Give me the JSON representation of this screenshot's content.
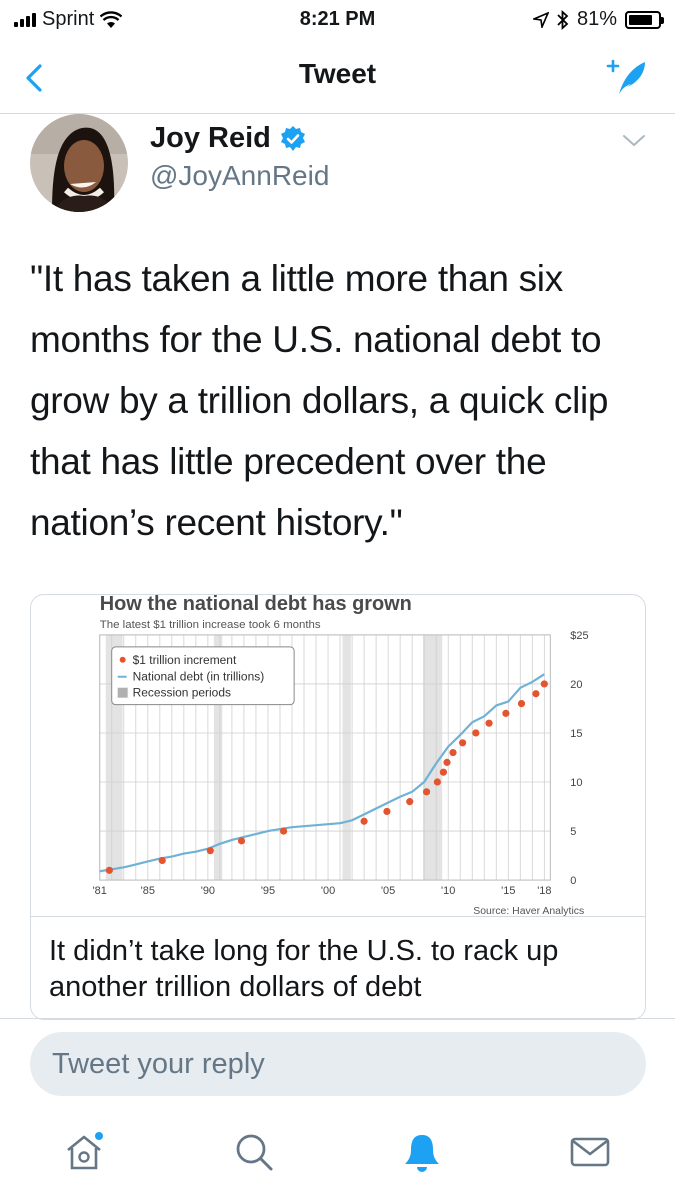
{
  "status_bar": {
    "carrier": "Sprint",
    "time": "8:21 PM",
    "battery": "81%",
    "battery_level": 0.81
  },
  "nav": {
    "title": "Tweet"
  },
  "tweet": {
    "author_name": "Joy Reid",
    "author_handle": "@JoyAnnReid",
    "text": "\"It has taken a little more than six months for the U.S. national debt to grow by a trillion dollars, a quick clip that has little precedent over the nation’s recent history.\""
  },
  "card": {
    "headline": "It didn’t take long for the U.S. to rack up another trillion dollars of debt"
  },
  "chart_data": {
    "type": "line",
    "title": "How the national debt has grown",
    "subtitle": "The latest $1 trillion increase took 6 months",
    "source": "Source: Haver Analytics",
    "legend": [
      "$1 trillion increment",
      "National debt (in trillions)",
      "Recession periods"
    ],
    "legend_placement": "top-left",
    "x_ticks": [
      "'81",
      "'85",
      "'90",
      "'95",
      "'00",
      "'05",
      "'10",
      "'15",
      "'18"
    ],
    "y_ticks": [
      "0",
      "5",
      "10",
      "15",
      "20",
      "$25"
    ],
    "xlim": [
      1981,
      2018.5
    ],
    "ylim": [
      0,
      25
    ],
    "grid": true,
    "recessions": [
      [
        1981.5,
        1982.9
      ],
      [
        1990.5,
        1991.2
      ],
      [
        2001.2,
        2001.9
      ],
      [
        2007.9,
        2009.5
      ]
    ],
    "series": [
      {
        "name": "National debt (in trillions)",
        "x": [
          1981,
          1982,
          1983,
          1984,
          1985,
          1986,
          1987,
          1988,
          1989,
          1990,
          1991,
          1992,
          1993,
          1994,
          1995,
          1996,
          1997,
          1998,
          1999,
          2000,
          2001,
          2002,
          2003,
          2004,
          2005,
          2006,
          2007,
          2008,
          2009,
          2010,
          2011,
          2012,
          2013,
          2014,
          2015,
          2016,
          2017,
          2018
        ],
        "y": [
          0.9,
          1.1,
          1.3,
          1.6,
          1.9,
          2.2,
          2.4,
          2.7,
          2.9,
          3.2,
          3.7,
          4.1,
          4.4,
          4.7,
          5.0,
          5.2,
          5.4,
          5.5,
          5.6,
          5.7,
          5.8,
          6.1,
          6.7,
          7.3,
          7.9,
          8.5,
          9.0,
          10.0,
          11.9,
          13.6,
          14.8,
          16.1,
          16.7,
          17.8,
          18.2,
          19.6,
          20.2,
          21.0
        ]
      },
      {
        "name": "$1 trillion increment",
        "x": [
          1981.8,
          1986.2,
          1990.2,
          1992.8,
          1996.3,
          2003.0,
          2004.9,
          2006.8,
          2008.2,
          2009.1,
          2009.6,
          2009.9,
          2010.4,
          2011.2,
          2012.3,
          2013.4,
          2014.8,
          2016.1,
          2017.3,
          2018.0
        ],
        "y": [
          1,
          2,
          3,
          4,
          5,
          6,
          7,
          8,
          9,
          10,
          11,
          12,
          13,
          14,
          15,
          16,
          17,
          18,
          19,
          20
        ]
      }
    ]
  },
  "reply": {
    "placeholder": "Tweet your reply"
  },
  "colors": {
    "accent": "#1da1f2",
    "line": "#6fb2d6",
    "dot": "#e3542f",
    "recession": "#e3e3e3"
  },
  "icons": {
    "back": "chevron-left-icon",
    "compose": "compose-icon",
    "verified": "verified-badge-icon",
    "home": "home-icon",
    "search": "search-icon",
    "notifications": "bell-icon",
    "messages": "envelope-icon"
  }
}
